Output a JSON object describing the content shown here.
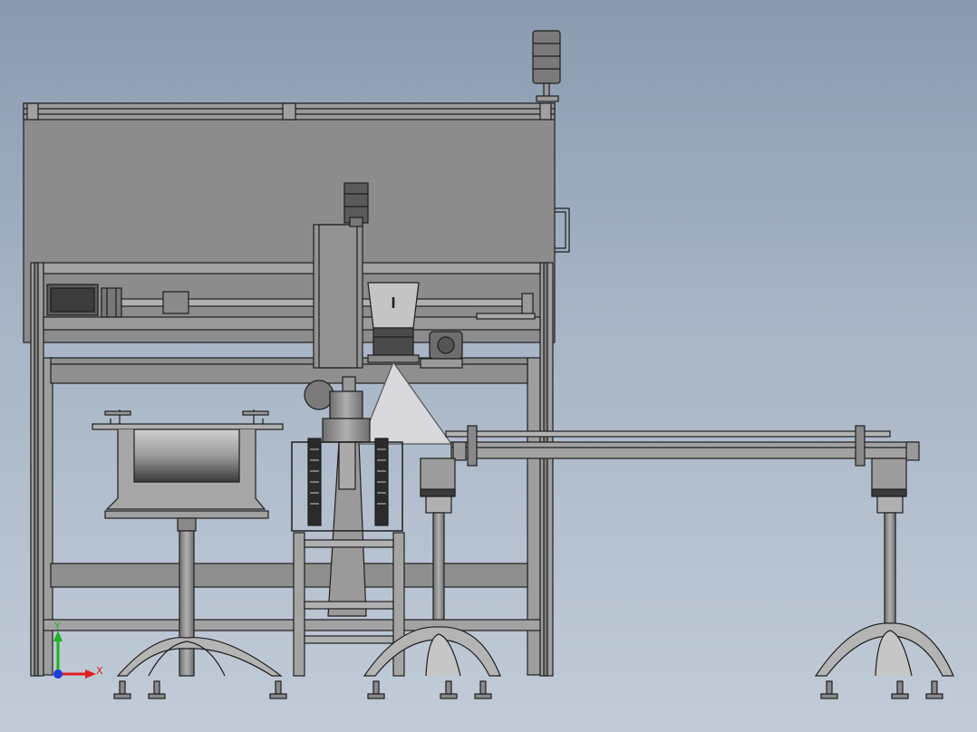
{
  "viewport": {
    "background_top": "#8a9bb0",
    "background_bottom": "#c2ccd8"
  },
  "model": {
    "body_color": "#8e8e8e",
    "edge_color": "#1e1e1e",
    "panel_color": "#8c8c8c",
    "light_part_color": "#d9d9dd"
  },
  "triad": {
    "x_label": "X",
    "y_label": "Y",
    "x_color": "#e01e1e",
    "y_color": "#1eb41e",
    "z_color": "#1e3cdc"
  }
}
